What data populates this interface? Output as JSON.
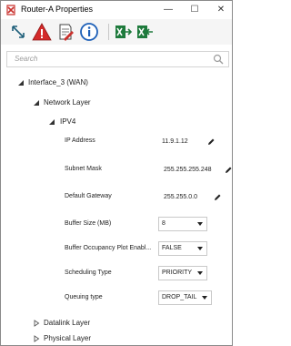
{
  "window": {
    "title": "Router-A Properties",
    "controls": {
      "minimize": "—",
      "maximize": "☐",
      "close": "✕"
    }
  },
  "toolbar": {
    "buttons": [
      {
        "icon": "expand-arrows-icon"
      },
      {
        "icon": "warning-icon"
      },
      {
        "icon": "notes-icon"
      },
      {
        "icon": "info-icon"
      },
      {
        "icon": "export-excel-icon"
      },
      {
        "icon": "import-excel-icon"
      }
    ]
  },
  "search": {
    "placeholder": "Search"
  },
  "tree": {
    "interface": {
      "label": "Interface_3 (WAN)",
      "expanded": true
    },
    "network_layer": {
      "label": "Network Layer",
      "expanded": true
    },
    "ipv4": {
      "label": "IPV4",
      "expanded": true
    },
    "properties": [
      {
        "label": "IP Address",
        "value": "11.9.1.12",
        "kind": "edit"
      },
      {
        "label": "Subnet Mask",
        "value": "255.255.255.248",
        "kind": "edit"
      },
      {
        "label": "Default Gateway",
        "value": "255.255.0.0",
        "kind": "edit"
      },
      {
        "label": "Buffer Size (MB)",
        "value": "8",
        "kind": "dropdown"
      },
      {
        "label": "Buffer Occupancy Plot Enabl...",
        "value": "FALSE",
        "kind": "dropdown"
      },
      {
        "label": "Scheduling Type",
        "value": "PRIORITY",
        "kind": "dropdown"
      },
      {
        "label": "Queuing type",
        "value": "DROP_TAIL",
        "kind": "dropdown"
      }
    ],
    "datalink_layer": {
      "label": "Datalink Layer",
      "expanded": false
    },
    "physical_layer": {
      "label": "Physical Layer",
      "expanded": false
    }
  },
  "colors": {
    "accent_red": "#d42a2a",
    "excel_green": "#1e7a3c",
    "info_blue": "#1c5fb8"
  }
}
